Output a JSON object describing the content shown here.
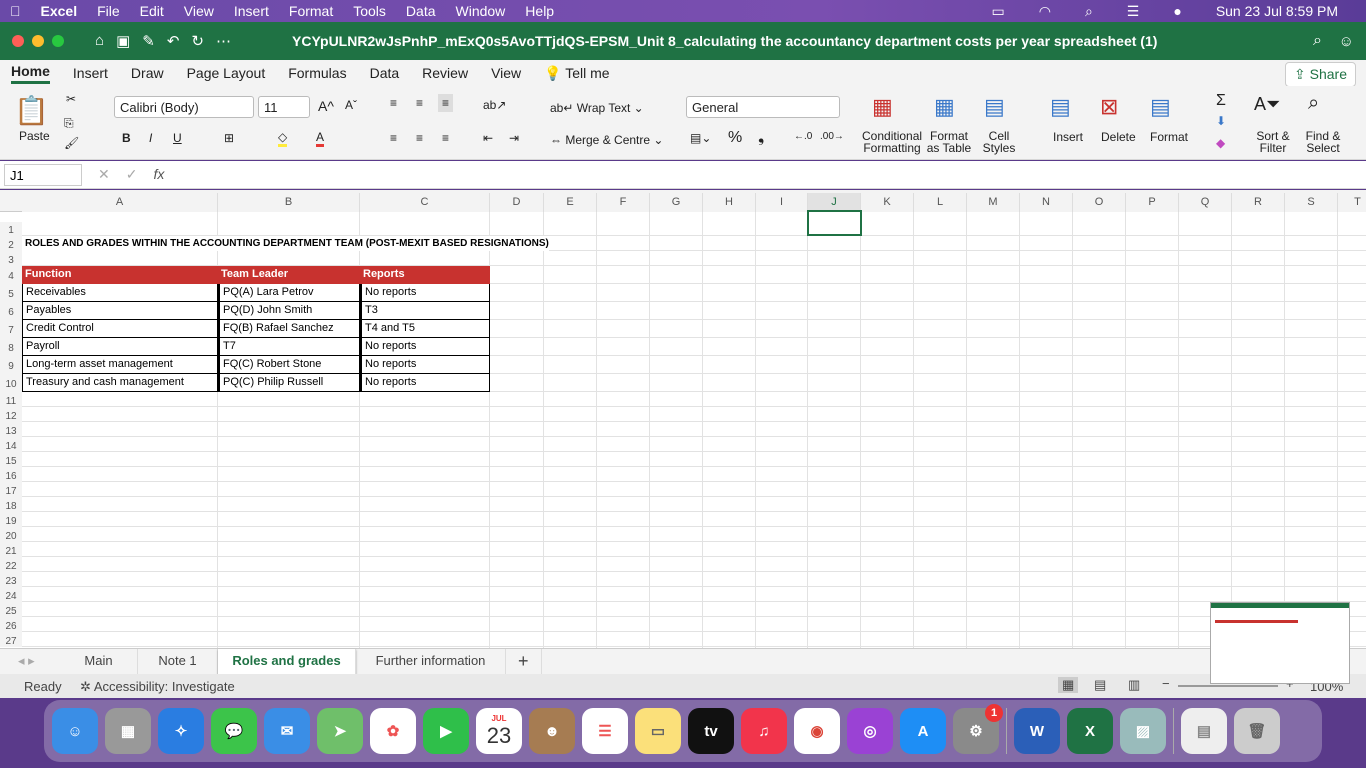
{
  "menubar": {
    "app": "Excel",
    "items": [
      "File",
      "Edit",
      "View",
      "Insert",
      "Format",
      "Tools",
      "Data",
      "Window",
      "Help"
    ],
    "datetime": "Sun 23 Jul  8:59 PM"
  },
  "window": {
    "title": "YCYpULNR2wJsPnhP_mExQ0s5AvoTTjdQS-EPSM_Unit 8_calculating the accountancy department costs per year spreadsheet (1)"
  },
  "ribbon_tabs": [
    "Home",
    "Insert",
    "Draw",
    "Page Layout",
    "Formulas",
    "Data",
    "Review",
    "View"
  ],
  "tell_me": "Tell me",
  "share": "Share",
  "ribbon": {
    "paste": "Paste",
    "font": "Calibri (Body)",
    "size": "11",
    "wrap_text": "Wrap Text",
    "merge": "Merge & Centre",
    "number_format": "General",
    "conditional": "Conditional Formatting",
    "format_table": "Format as Table",
    "cell_styles": "Cell Styles",
    "insert": "Insert",
    "delete": "Delete",
    "format": "Format",
    "sort": "Sort & Filter",
    "find": "Find & Select"
  },
  "formula_bar": {
    "name_box": "J1",
    "formula": ""
  },
  "columns": [
    "A",
    "B",
    "C",
    "D",
    "E",
    "F",
    "G",
    "H",
    "I",
    "J",
    "K",
    "L",
    "M",
    "N",
    "O",
    "P",
    "Q",
    "R",
    "S",
    "T"
  ],
  "sheet": {
    "title": "ROLES AND GRADES WITHIN THE ACCOUNTING DEPARTMENT TEAM (POST-MEXIT BASED RESIGNATIONS)",
    "headers": [
      "Function",
      "Team Leader",
      "Reports"
    ],
    "rows": [
      [
        "Receivables",
        "PQ(A) Lara Petrov",
        "No reports"
      ],
      [
        "Payables",
        "PQ(D) John Smith",
        "T3"
      ],
      [
        "Credit Control",
        "FQ(B) Rafael Sanchez",
        "T4 and T5"
      ],
      [
        "Payroll",
        "T7",
        "No reports"
      ],
      [
        "Long-term asset management",
        "FQ(C) Robert Stone",
        "No reports"
      ],
      [
        "Treasury and cash management",
        "PQ(C) Philip Russell",
        "No reports"
      ]
    ],
    "header_color": "#c8322f"
  },
  "sheet_tabs": [
    "Main",
    "Note 1",
    "Roles and grades",
    "Further information"
  ],
  "active_sheet": "Roles and grades",
  "status": {
    "ready": "Ready",
    "accessibility": "Accessibility: Investigate",
    "zoom": "100%"
  },
  "dock": {
    "calendar_month": "JUL",
    "calendar_day": "23",
    "settings_badge": "1",
    "tv": "tv"
  }
}
